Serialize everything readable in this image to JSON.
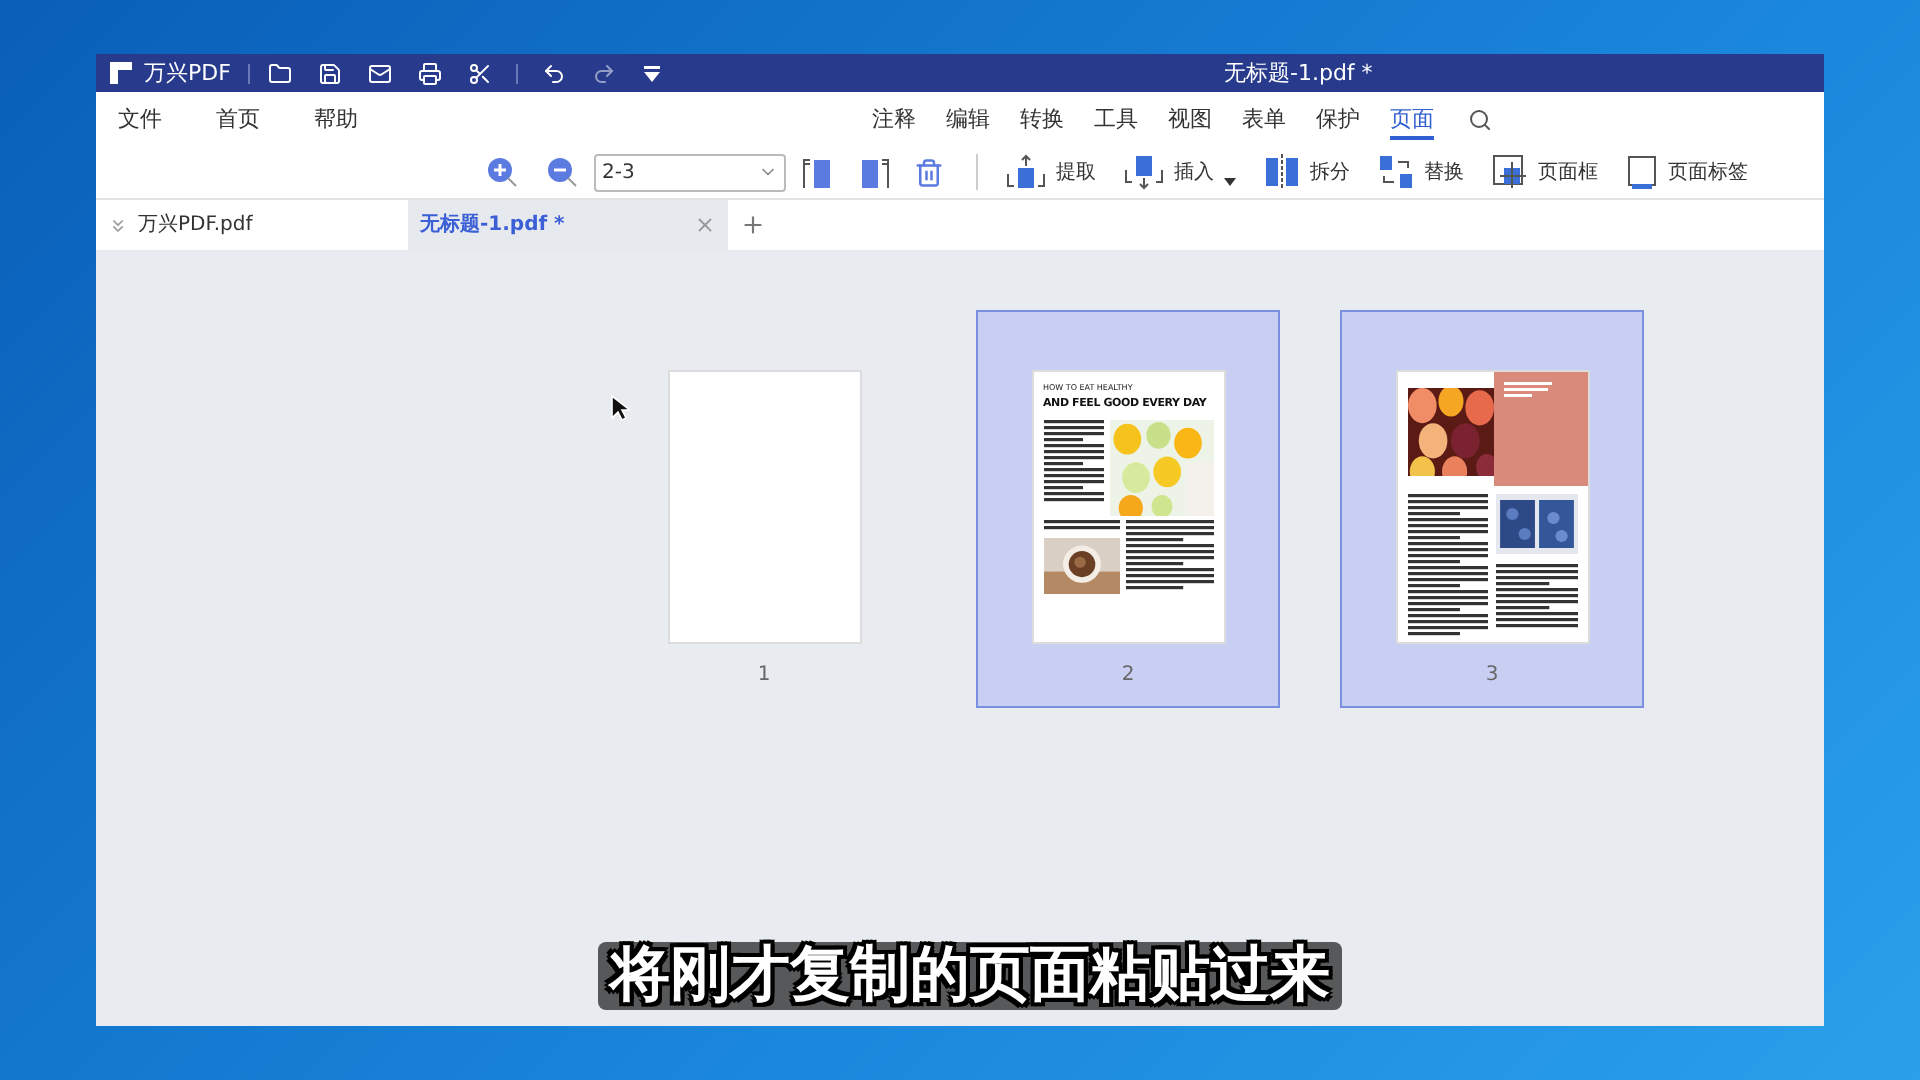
{
  "app": {
    "name": "万兴PDF",
    "title": "无标题-1.pdf *"
  },
  "menu": [
    "文件",
    "首页",
    "帮助"
  ],
  "ribbon_tabs": [
    {
      "label": "注释",
      "selected": false
    },
    {
      "label": "编辑",
      "selected": false
    },
    {
      "label": "转换",
      "selected": false
    },
    {
      "label": "工具",
      "selected": false
    },
    {
      "label": "视图",
      "selected": false
    },
    {
      "label": "表单",
      "selected": false
    },
    {
      "label": "保护",
      "selected": false
    },
    {
      "label": "页面",
      "selected": true
    }
  ],
  "toolbar": {
    "page_range": "2-3",
    "actions": [
      {
        "label": "提取",
        "kind": "extract",
        "dropdown": false
      },
      {
        "label": "插入",
        "kind": "insert",
        "dropdown": true
      },
      {
        "label": "拆分",
        "kind": "split",
        "dropdown": false
      },
      {
        "label": "替换",
        "kind": "replace",
        "dropdown": false
      },
      {
        "label": "页面框",
        "kind": "box",
        "dropdown": false
      },
      {
        "label": "页面标签",
        "kind": "label",
        "dropdown": false
      }
    ]
  },
  "doc_tabs": [
    {
      "label": "万兴PDF.pdf",
      "selected": false
    },
    {
      "label": "无标题-1.pdf *",
      "selected": true
    }
  ],
  "pages": [
    {
      "number": "1",
      "selected": false,
      "kind": "blank"
    },
    {
      "number": "2",
      "selected": true,
      "kind": "article",
      "kicker": "HOW TO EAT HEALTHY",
      "headline": "AND FEEL GOOD EVERY DAY"
    },
    {
      "number": "3",
      "selected": true,
      "kind": "fruit"
    }
  ],
  "caption": "将刚才复制的页面粘贴过来"
}
